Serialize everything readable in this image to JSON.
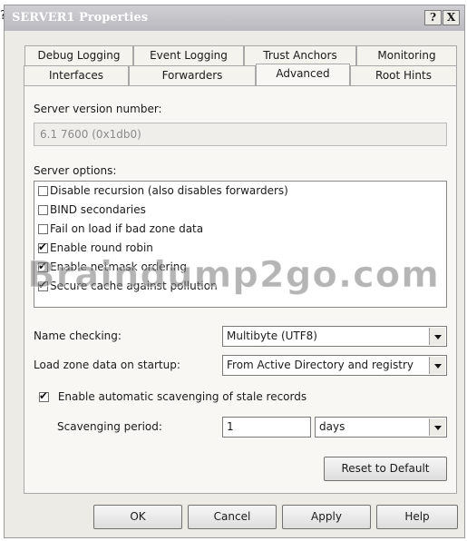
{
  "window": {
    "title": "SERVER1 Properties",
    "help_label": "?",
    "close_label": "X"
  },
  "tabs": {
    "row1": [
      "Debug Logging",
      "Event Logging",
      "Trust Anchors",
      "Monitoring"
    ],
    "row2": [
      "Interfaces",
      "Forwarders",
      "Advanced",
      "Root Hints"
    ],
    "active": "Advanced"
  },
  "advanced": {
    "version_label": "Server version number:",
    "version_value": "6.1 7600 (0x1db0)",
    "options_label": "Server options:",
    "options": [
      {
        "label": "Disable recursion (also disables forwarders)",
        "checked": false
      },
      {
        "label": "BIND secondaries",
        "checked": false
      },
      {
        "label": "Fail on load if bad zone data",
        "checked": false
      },
      {
        "label": "Enable round robin",
        "checked": true
      },
      {
        "label": "Enable netmask ordering",
        "checked": true
      },
      {
        "label": "Secure cache against pollution",
        "checked": true
      }
    ],
    "name_checking_label": "Name checking:",
    "name_checking_value": "Multibyte (UTF8)",
    "load_zone_label": "Load zone data on startup:",
    "load_zone_value": "From Active Directory and registry",
    "scavenging_checkbox_label": "Enable automatic scavenging of stale records",
    "scavenging_checked": true,
    "scavenging_period_label": "Scavenging period:",
    "scavenging_period_value": "1",
    "scavenging_unit": "days",
    "reset_label": "Reset to Default"
  },
  "footer": {
    "ok": "OK",
    "cancel": "Cancel",
    "apply": "Apply",
    "help": "Help"
  },
  "watermark": "Braindump2go.com",
  "page_marker": "?"
}
